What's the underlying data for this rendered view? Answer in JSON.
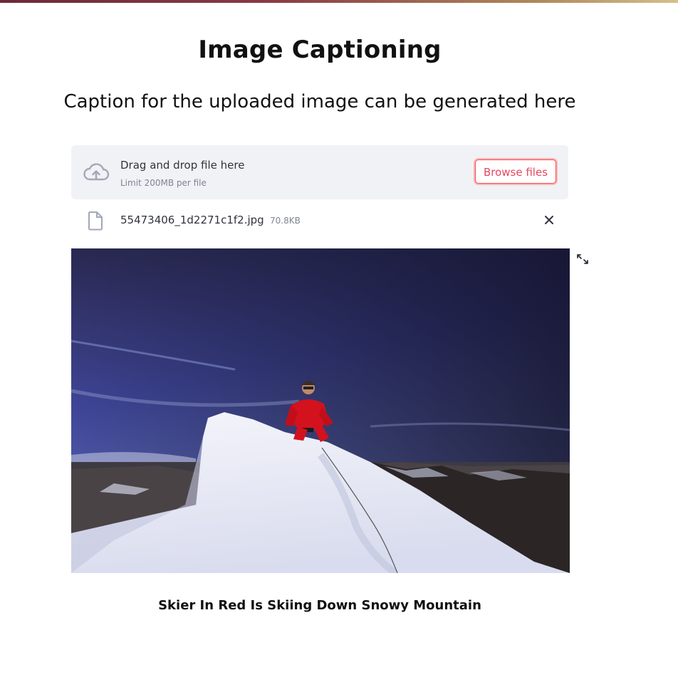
{
  "app": {
    "title": "Image Captioning",
    "subtitle": "Caption for the uploaded image can be generated here"
  },
  "uploader": {
    "drag_text": "Drag and drop file here",
    "limit_text": "Limit 200MB per file",
    "browse_label": "Browse files",
    "icon": "cloud-upload-icon"
  },
  "uploaded_file": {
    "name": "55473406_1d2271c1f2.jpg",
    "size": "70.8KB",
    "icon": "file-icon",
    "remove_icon": "close-icon"
  },
  "image": {
    "fullscreen_icon": "fullscreen-expand-icon"
  },
  "result": {
    "caption": "Skier In Red Is Skiing Down Snowy Mountain"
  },
  "colors": {
    "accent": "#ff4b4b",
    "dropzone_bg": "#f0f2f6",
    "icon_gray": "#a3a8b8"
  }
}
